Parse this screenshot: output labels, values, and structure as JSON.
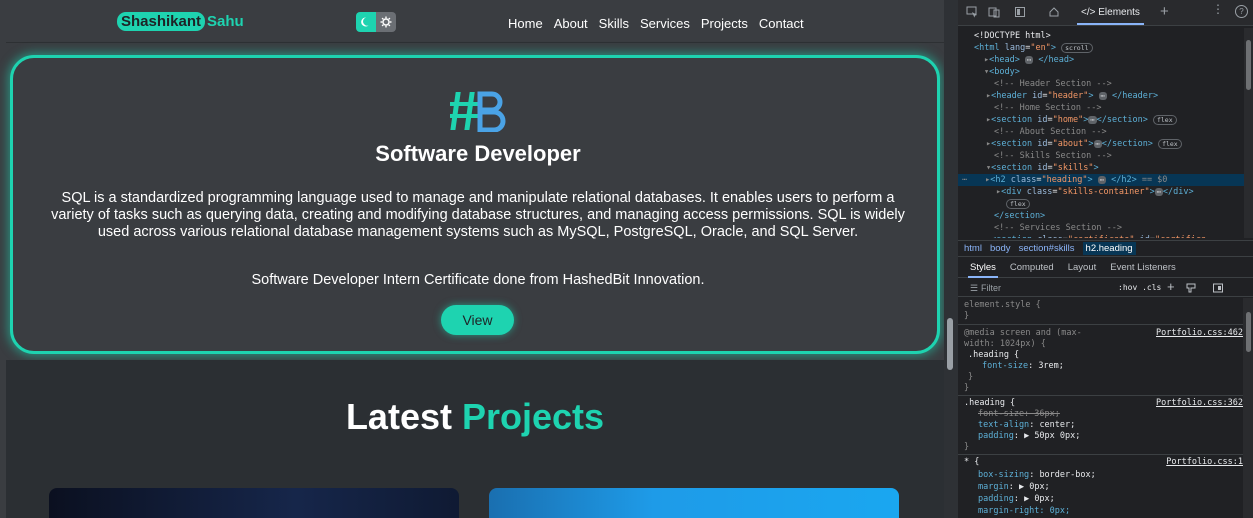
{
  "site": {
    "logo_first": "Shashikant",
    "logo_last": "Sahu",
    "nav": [
      "Home",
      "About",
      "Skills",
      "Services",
      "Projects",
      "Contact"
    ],
    "certificate": {
      "title": "Software Developer",
      "description": "SQL is a standardized programming language used to manage and manipulate relational databases. It enables users to perform a variety of tasks such as querying data, creating and modifying database structures, and managing access permissions. SQL is widely used across various relational database management systems such as MySQL, PostgreSQL, Oracle, and SQL Server.",
      "note": "Software Developer Intern Certificate done from HashedBit Innovation.",
      "button": "View"
    },
    "projects": {
      "title_main": "Latest",
      "title_accent": "Projects"
    },
    "colors": {
      "accent": "#1ed3b0",
      "background": "#3a3d41"
    }
  },
  "devtools": {
    "tab_label": "</> Elements",
    "dom": [
      {
        "indent": 0,
        "text": "<!DOCTYPE html>"
      },
      {
        "indent": 1,
        "text": "<html lang=\"en\">"
      },
      {
        "indent": 2,
        "text": "<head> … </head>"
      },
      {
        "indent": 2,
        "text": "<body>"
      },
      {
        "indent": 3,
        "text": "<!-- Header Section -->"
      },
      {
        "indent": 3,
        "text": "<header id=\"header\"> … </header>"
      },
      {
        "indent": 3,
        "text": "<!-- Home Section  -->"
      },
      {
        "indent": 3,
        "text": "<section id=\"home\"> … </section>"
      },
      {
        "indent": 3,
        "text": "<!-- About Section -->"
      },
      {
        "indent": 3,
        "text": "<section id=\"about\"> … </section>"
      },
      {
        "indent": 3,
        "text": "<!-- Skills Section -->"
      },
      {
        "indent": 3,
        "text": "<section id=\"skills\">"
      },
      {
        "indent": 4,
        "text": "<h2 class=\"heading\"> … </h2> == $0"
      },
      {
        "indent": 4,
        "text": "<div class=\"skills-container\"> … </div>"
      },
      {
        "indent": 3,
        "text": "</section>"
      },
      {
        "indent": 3,
        "text": "<!-- Services Section -->"
      },
      {
        "indent": 3,
        "text": "<section class=\"certificate\" id=\"certifica"
      }
    ],
    "scroll_pill": "scroll",
    "flex_pill": "flex",
    "breadcrumbs": [
      "html",
      "body",
      "section#skills",
      "h2.heading"
    ],
    "style_tabs": [
      "Styles",
      "Computed",
      "Layout",
      "Event Listeners"
    ],
    "filter_placeholder": "Filter",
    "filter_tools": ":hov .cls",
    "rules": {
      "element_style": "element.style {",
      "media_1": "@media screen and (max-",
      "media_2": "width: 1024px) {",
      "media_sel": ".heading {",
      "media_prop": "font-size",
      "media_val": "3rem;",
      "media_src": "Portfolio.css:462",
      "heading_sel": ".heading {",
      "heading_src": "Portfolio.css:362",
      "heading_fs": "font-size: 36px;",
      "heading_ta_prop": "text-align",
      "heading_ta_val": "center;",
      "heading_pad_prop": "padding",
      "heading_pad_val": "▶ 50px 0px;",
      "star_sel": "* {",
      "star_src": "Portfolio.css:1",
      "star_bs_prop": "box-sizing",
      "star_bs_val": "border-box;",
      "star_margin_prop": "margin",
      "star_margin_val": "▶ 0px;",
      "star_padding_prop": "padding",
      "star_padding_val": "▶ 0px;",
      "star_mr": "margin-right: 0px;"
    }
  }
}
